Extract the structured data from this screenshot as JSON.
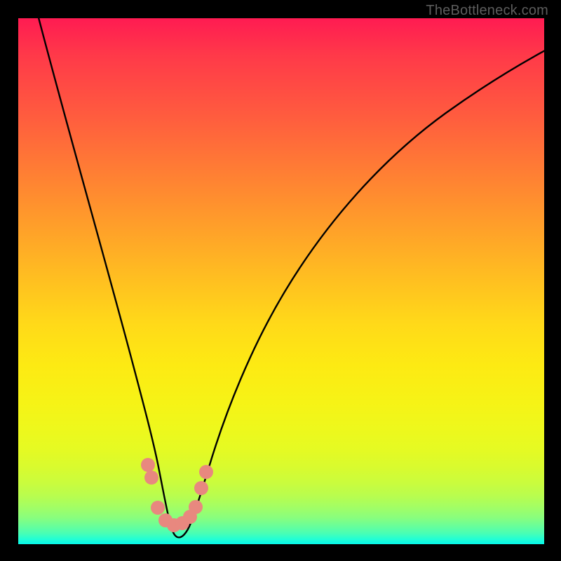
{
  "watermark": "TheBottleneck.com",
  "chart_data": {
    "type": "line",
    "title": "",
    "xlabel": "",
    "ylabel": "",
    "xlim": [
      0,
      100
    ],
    "ylim": [
      0,
      100
    ],
    "grid": false,
    "background_gradient": {
      "orientation": "vertical",
      "stops": [
        {
          "pos": 0.0,
          "color": "#ff1b52"
        },
        {
          "pos": 0.5,
          "color": "#ffd015"
        },
        {
          "pos": 0.8,
          "color": "#e7fa20"
        },
        {
          "pos": 1.0,
          "color": "#06f7ea"
        }
      ]
    },
    "series": [
      {
        "name": "bottleneck-curve",
        "color": "#000000",
        "x": [
          3,
          5,
          8,
          11,
          14,
          17,
          20,
          22,
          24,
          26,
          27,
          28,
          29,
          30,
          31,
          33,
          35,
          38,
          42,
          47,
          53,
          60,
          68,
          77,
          87,
          98
        ],
        "y": [
          100,
          90,
          78,
          66,
          54,
          42,
          30,
          22,
          14,
          8,
          5,
          3,
          2,
          2,
          3,
          5,
          9,
          15,
          23,
          32,
          42,
          52,
          61,
          69,
          76,
          82
        ]
      }
    ],
    "markers": [
      {
        "name": "left-segment-dots",
        "color": "#e8887f",
        "radius": 10,
        "points": [
          {
            "x": 24.3,
            "y": 14.5
          },
          {
            "x": 25.0,
            "y": 12.0
          },
          {
            "x": 26.2,
            "y": 6.0
          },
          {
            "x": 27.5,
            "y": 4.0
          },
          {
            "x": 29.0,
            "y": 3.5
          },
          {
            "x": 30.7,
            "y": 4.0
          },
          {
            "x": 32.2,
            "y": 5.0
          },
          {
            "x": 33.5,
            "y": 7.0
          },
          {
            "x": 34.7,
            "y": 10.5
          },
          {
            "x": 35.5,
            "y": 13.5
          }
        ]
      }
    ]
  }
}
